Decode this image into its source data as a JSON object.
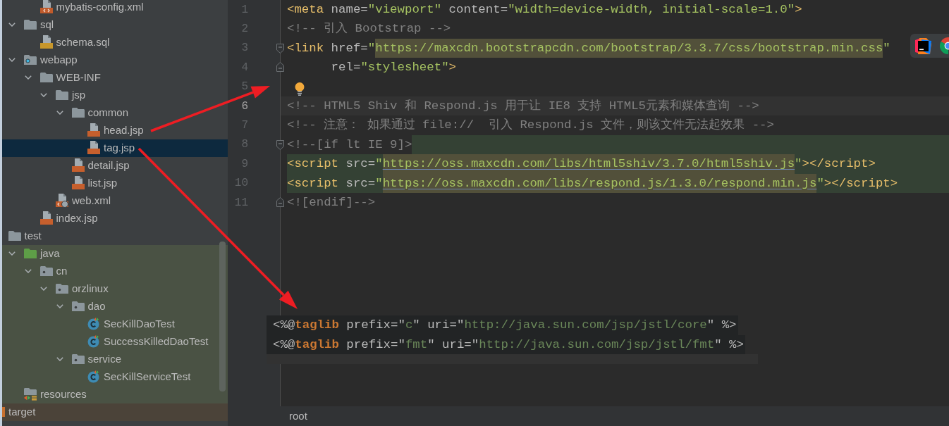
{
  "project_tree": {
    "items": [
      {
        "children": [
          {
            "children": [
              {
                "children": [
                  {
                    "label": "mybatis-config.xml",
                    "kind": "xml-file",
                    "selected": false
                  }
                ]
              },
              {
                "label": "sql",
                "kind": "folder",
                "expanded": true,
                "selected": false,
                "children": [
                  {
                    "label": "schema.sql",
                    "kind": "sql-file",
                    "selected": false
                  }
                ]
              },
              {
                "label": "webapp",
                "kind": "web-folder",
                "expanded": true,
                "selected": false,
                "children": [
                  {
                    "label": "WEB-INF",
                    "kind": "folder",
                    "expanded": true,
                    "selected": false,
                    "children": [
                      {
                        "label": "jsp",
                        "kind": "folder",
                        "expanded": true,
                        "selected": false,
                        "children": [
                          {
                            "label": "common",
                            "kind": "folder",
                            "expanded": true,
                            "selected": false,
                            "children": [
                              {
                                "label": "head.jsp",
                                "kind": "jsp-file",
                                "selected": false
                              },
                              {
                                "label": "tag.jsp",
                                "kind": "jsp-file",
                                "selected": true
                              }
                            ]
                          },
                          {
                            "label": "detail.jsp",
                            "kind": "jsp-file",
                            "selected": false
                          },
                          {
                            "label": "list.jsp",
                            "kind": "jsp-file",
                            "selected": false
                          }
                        ]
                      },
                      {
                        "label": "web.xml",
                        "kind": "web-xml-file",
                        "selected": false
                      }
                    ]
                  },
                  {
                    "label": "index.jsp",
                    "kind": "jsp-file",
                    "selected": false
                  }
                ]
              }
            ]
          },
          {
            "label": "test",
            "kind": "folder",
            "selected": false,
            "children": [
              {
                "label": "java",
                "kind": "source-folder",
                "expanded": true,
                "selected": false,
                "test_source": true,
                "children": [
                  {
                    "label": "cn",
                    "kind": "package",
                    "expanded": true,
                    "selected": false,
                    "test_source": true,
                    "children": [
                      {
                        "label": "orzlinux",
                        "kind": "package",
                        "expanded": true,
                        "selected": false,
                        "test_source": true,
                        "children": [
                          {
                            "label": "dao",
                            "kind": "package",
                            "expanded": true,
                            "selected": false,
                            "test_source": true,
                            "children": [
                              {
                                "label": "SecKillDaoTest",
                                "kind": "test-class",
                                "selected": false,
                                "test_source": true
                              },
                              {
                                "label": "SuccessKilledDaoTest",
                                "kind": "test-class",
                                "selected": false,
                                "test_source": true
                              }
                            ]
                          },
                          {
                            "label": "service",
                            "kind": "package",
                            "expanded": true,
                            "selected": false,
                            "test_source": true,
                            "children": [
                              {
                                "label": "SecKillServiceTest",
                                "kind": "test-class",
                                "selected": false,
                                "test_source": true
                              }
                            ]
                          }
                        ]
                      }
                    ]
                  }
                ]
              },
              {
                "label": "resources",
                "kind": "resource-folder",
                "selected": false,
                "test_source": true
              }
            ]
          }
        ]
      },
      {
        "label": "target",
        "kind": "excluded-folder",
        "selected": false,
        "excluded": true
      }
    ]
  },
  "editor": {
    "lines": [
      {
        "number": "1",
        "current": false,
        "tokens": [
          {
            "text": "<meta",
            "kind": "tag"
          },
          {
            "text": " name=",
            "kind": "attr"
          },
          {
            "text": "\"viewport\"",
            "kind": "value"
          },
          {
            "text": " content=",
            "kind": "attr"
          },
          {
            "text": "\"width=device-width, initial-scale=1.0\"",
            "kind": "value"
          },
          {
            "text": ">",
            "kind": "tag"
          }
        ]
      },
      {
        "number": "2",
        "current": false,
        "tokens": [
          {
            "text": "<!-- 引入 Bootstrap -->",
            "kind": "comment"
          }
        ]
      },
      {
        "number": "3",
        "current": false,
        "fold_start": true,
        "tokens": [
          {
            "text": "<link",
            "kind": "tag"
          },
          {
            "text": " href=",
            "kind": "attr"
          },
          {
            "text": "\"",
            "kind": "value"
          },
          {
            "text": "https://maxcdn.bootstrapcdn.com/bootstrap/3.3.7/css/bootstrap.min.css",
            "kind": "url"
          },
          {
            "text": "\"",
            "kind": "value"
          }
        ]
      },
      {
        "number": "4",
        "current": false,
        "fold_end": true,
        "tokens": [
          {
            "text": "      rel=",
            "kind": "attr"
          },
          {
            "text": "\"stylesheet\"",
            "kind": "value"
          },
          {
            "text": ">",
            "kind": "tag"
          }
        ]
      },
      {
        "number": "5",
        "current": false,
        "bulb": true
      },
      {
        "number": "6",
        "current": true,
        "tokens": [
          {
            "text": "<!-- HTML5 Shiv 和 Respond.js 用于让 IE8 支持 HTML5元素和媒体查询 -->",
            "kind": "comment"
          }
        ]
      },
      {
        "number": "7",
        "current": false,
        "tokens": [
          {
            "text": "<!-- 注意： 如果通过 file://  引入 Respond.js 文件，则该文件无法起效果 -->",
            "kind": "comment"
          }
        ]
      },
      {
        "number": "8",
        "current": false,
        "fold_start": true,
        "injected_tail": true,
        "tokens": [
          {
            "text": "<!--[if lt IE 9]>",
            "kind": "comment"
          }
        ]
      },
      {
        "number": "9",
        "current": false,
        "injected": true,
        "tokens": [
          {
            "text": "<script",
            "kind": "tag"
          },
          {
            "text": " src=",
            "kind": "attr"
          },
          {
            "text": "\"",
            "kind": "value"
          },
          {
            "text": "https://oss.maxcdn.com/libs/html5shiv/3.7.0/html5shiv.js",
            "kind": "link"
          },
          {
            "text": "\"",
            "kind": "value"
          },
          {
            "text": "></script>",
            "kind": "tag"
          }
        ]
      },
      {
        "number": "10",
        "current": false,
        "injected": true,
        "tokens": [
          {
            "text": "<script",
            "kind": "tag"
          },
          {
            "text": " src=",
            "kind": "attr"
          },
          {
            "text": "\"",
            "kind": "value"
          },
          {
            "text": "https://oss.maxcdn.com/libs/respond.js/1.3.0/respond.min.js",
            "kind": "link"
          },
          {
            "text": "\"",
            "kind": "value"
          },
          {
            "text": "></script>",
            "kind": "tag"
          }
        ]
      },
      {
        "number": "11",
        "current": false,
        "fold_end": true,
        "tokens": [
          {
            "text": "<![endif]-->",
            "kind": "comment"
          }
        ]
      }
    ]
  },
  "inset": {
    "lines": [
      {
        "current": false,
        "tokens": [
          {
            "text": "<%@",
            "kind": "plain"
          },
          {
            "text": "taglib",
            "kind": "keyword"
          },
          {
            "text": " prefix=\"",
            "kind": "plain"
          },
          {
            "text": "c",
            "kind": "value"
          },
          {
            "text": "\" uri=\"",
            "kind": "plain"
          },
          {
            "text": "http://java.sun.com/jsp/jstl/core",
            "kind": "value"
          },
          {
            "text": "\" %>",
            "kind": "plain"
          }
        ]
      },
      {
        "current": false,
        "tokens": [
          {
            "text": "<%@",
            "kind": "plain"
          },
          {
            "text": "taglib",
            "kind": "keyword"
          },
          {
            "text": " prefix=\"",
            "kind": "plain"
          },
          {
            "text": "fmt",
            "kind": "value"
          },
          {
            "text": "\" uri=\"",
            "kind": "plain"
          },
          {
            "text": "http://java.sun.com/jsp/jstl/fmt",
            "kind": "value"
          },
          {
            "text": "\" %>",
            "kind": "plain"
          }
        ]
      },
      {
        "current": true
      }
    ]
  },
  "breadcrumb": [
    "root"
  ]
}
